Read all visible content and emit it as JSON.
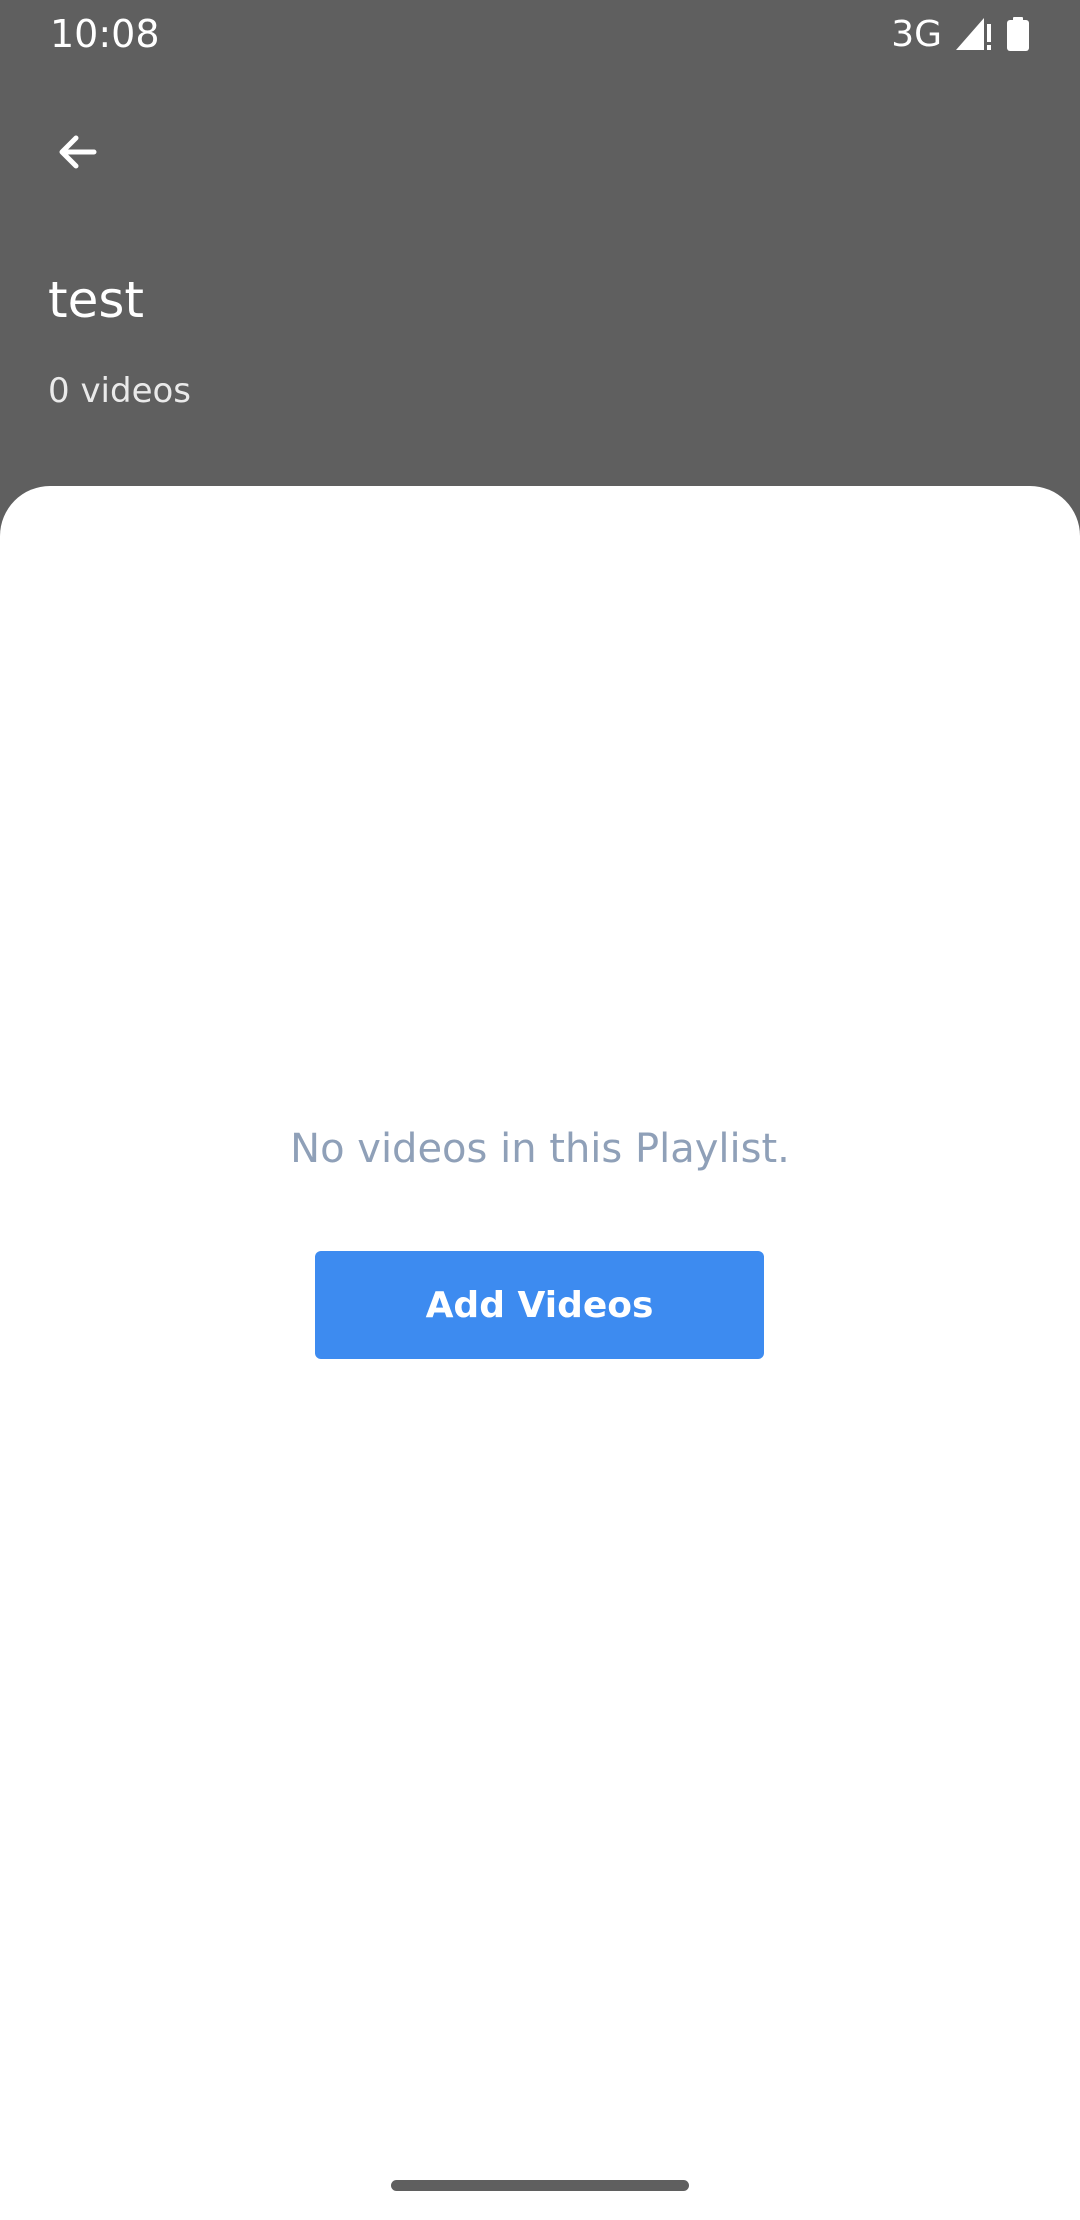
{
  "status_bar": {
    "time": "10:08",
    "network": "3G",
    "icons": [
      "signal-icon",
      "battery-icon"
    ]
  },
  "header": {
    "back_icon": "arrow-left-icon",
    "title": "test",
    "subtitle": "0 videos"
  },
  "content": {
    "empty_message": "No videos in this Playlist.",
    "add_button_label": "Add Videos"
  },
  "colors": {
    "header_background": "#5f5f5f",
    "sheet_background": "#ffffff",
    "empty_text": "#8fa0b8",
    "accent": "#3d8bf0"
  }
}
